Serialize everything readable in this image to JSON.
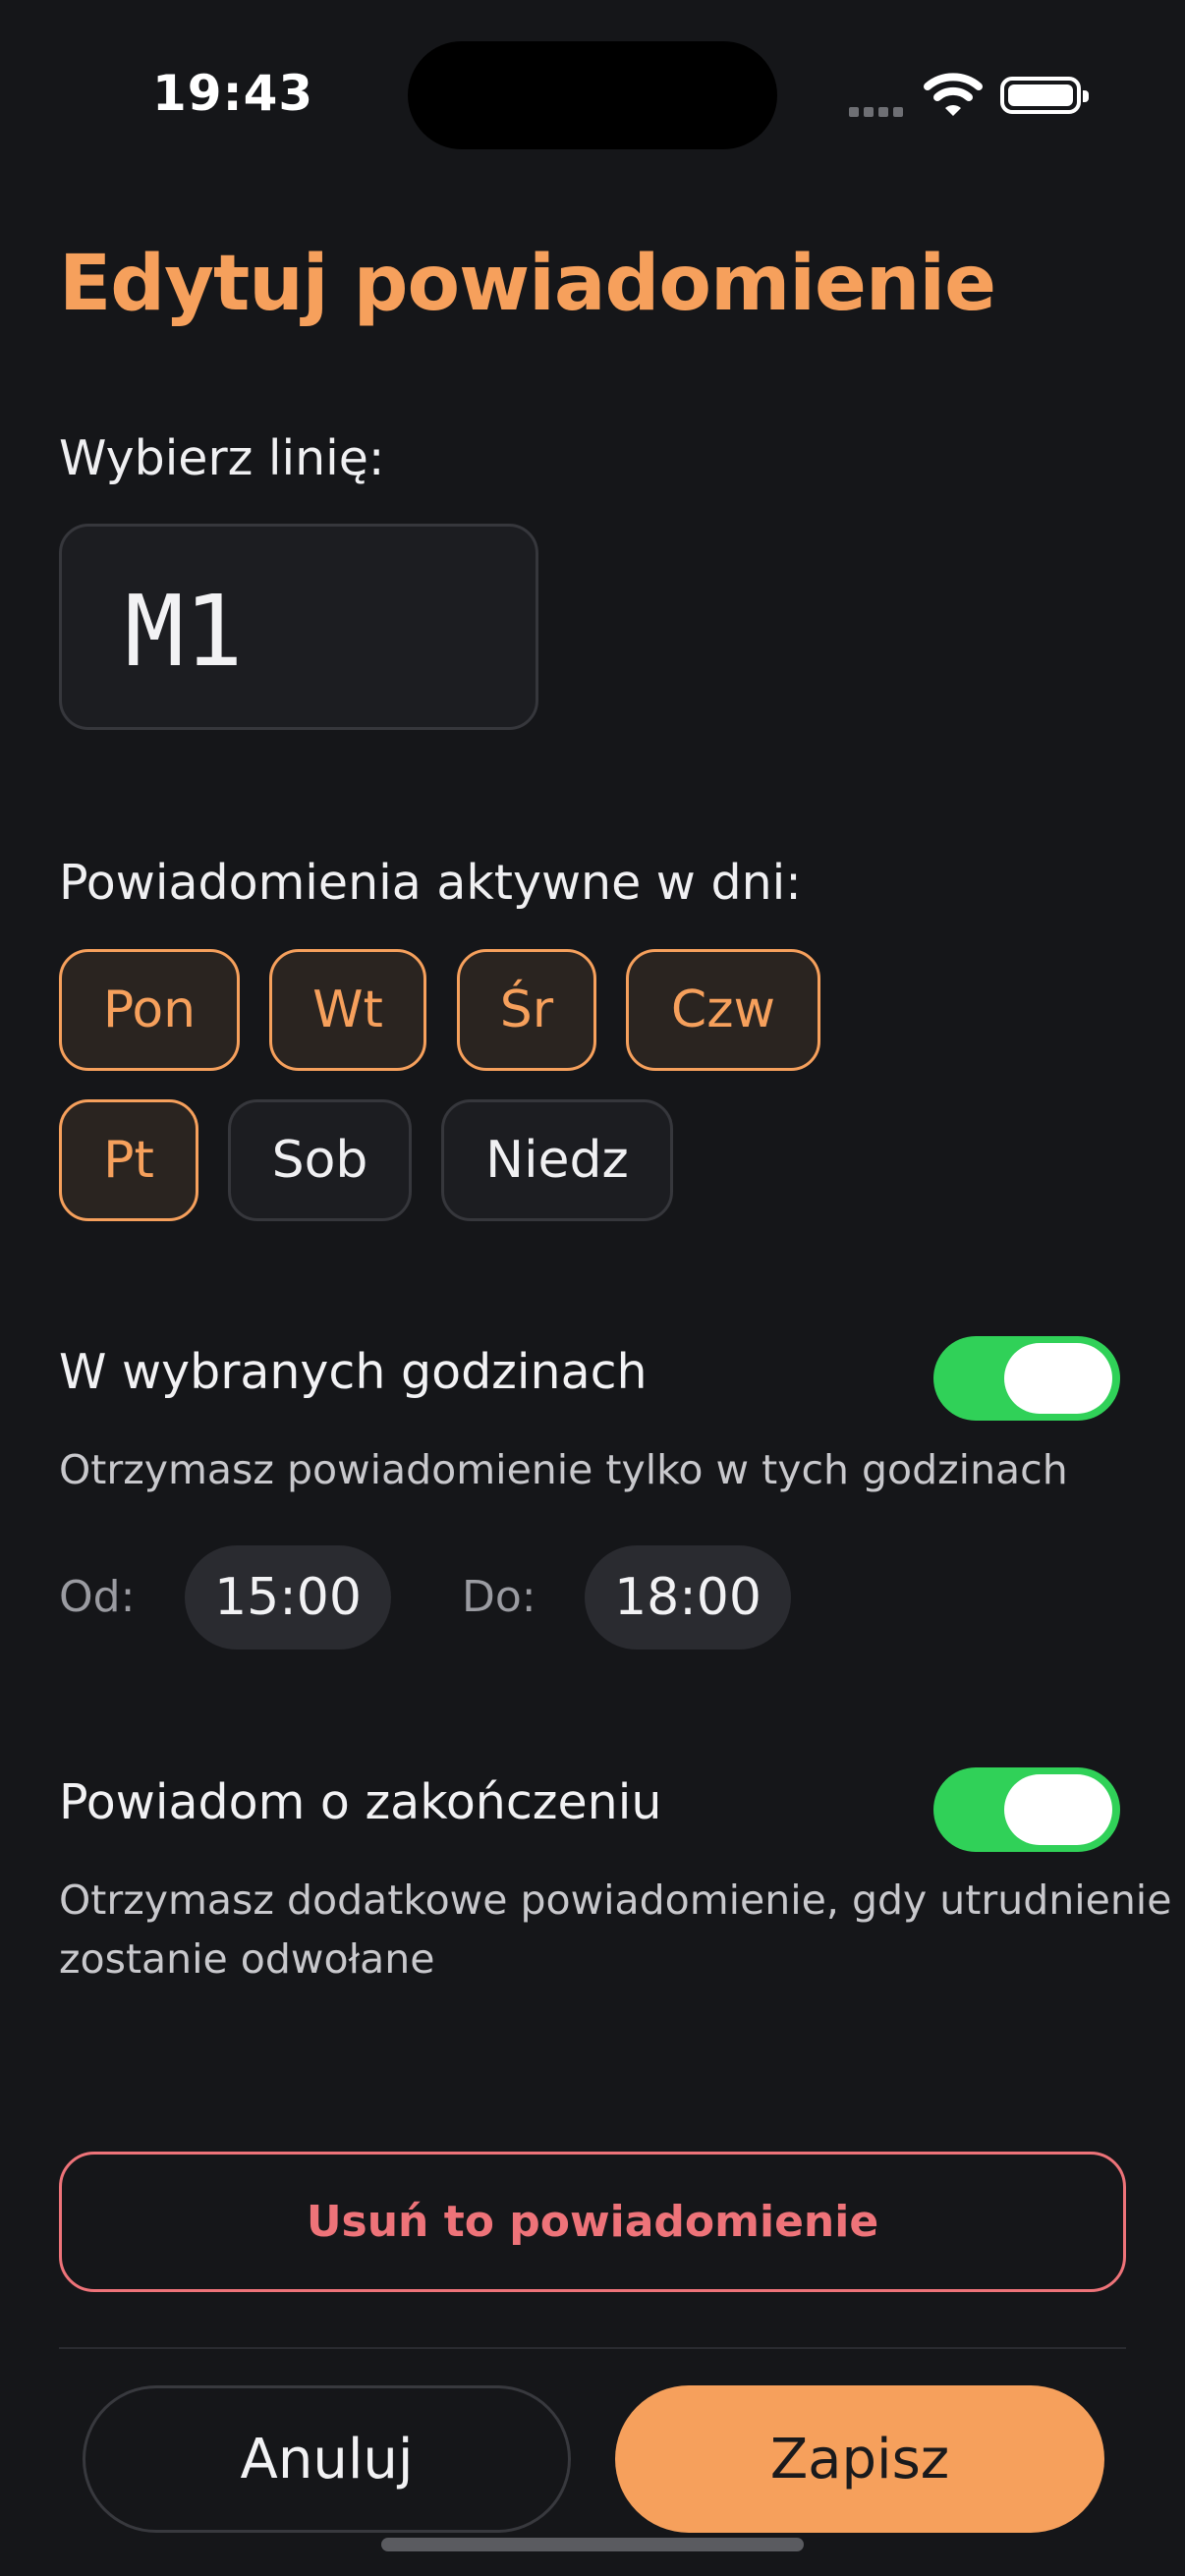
{
  "status_bar": {
    "time": "19:43"
  },
  "header": {
    "title": "Edytuj powiadomienie"
  },
  "line_select": {
    "label": "Wybierz linię:",
    "value": "M1"
  },
  "days": {
    "label": "Powiadomienia aktywne w dni:",
    "items": [
      {
        "label": "Pon",
        "selected": true
      },
      {
        "label": "Wt",
        "selected": true
      },
      {
        "label": "Śr",
        "selected": true
      },
      {
        "label": "Czw",
        "selected": true
      },
      {
        "label": "Pt",
        "selected": true
      },
      {
        "label": "Sob",
        "selected": false
      },
      {
        "label": "Niedz",
        "selected": false
      }
    ]
  },
  "hours": {
    "title": "W wybranych godzinach",
    "enabled": true,
    "description": "Otrzymasz powiadomienie tylko w tych godzinach",
    "from_label": "Od:",
    "from_value": "15:00",
    "to_label": "Do:",
    "to_value": "18:00"
  },
  "end_notify": {
    "title": "Powiadom o zakończeniu",
    "enabled": true,
    "description_line1": "Otrzymasz dodatkowe powiadomienie, gdy utrudnienie",
    "description_line2": "zostanie odwołane"
  },
  "actions": {
    "delete_label": "Usuń to powiadomienie",
    "cancel_label": "Anuluj",
    "save_label": "Zapisz"
  },
  "colors": {
    "accent": "#F6A05C",
    "toggle_on": "#30D158",
    "danger": "#EE7379",
    "background": "#151619"
  }
}
